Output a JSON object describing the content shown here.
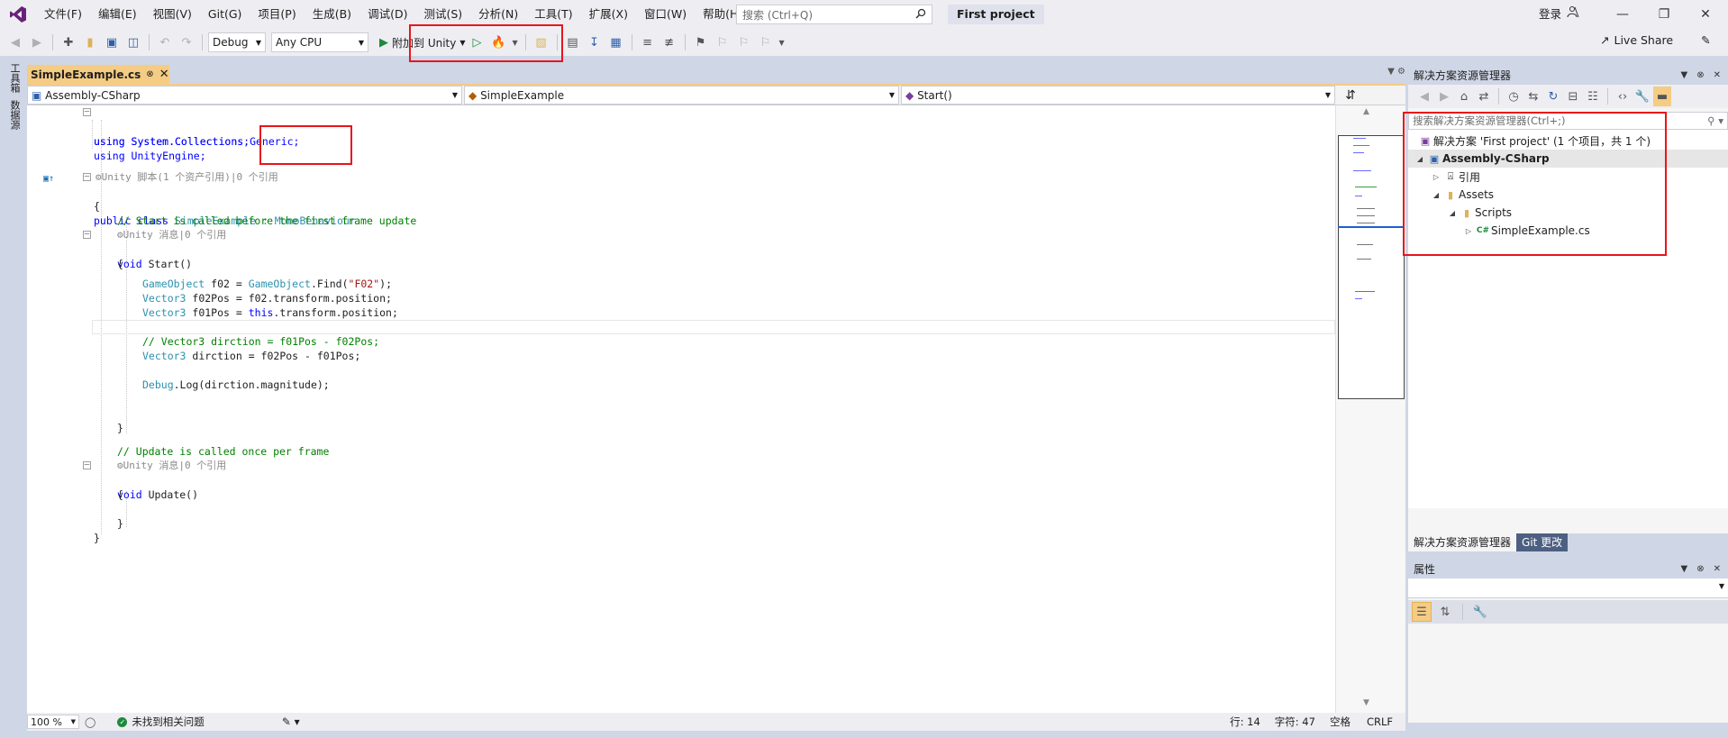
{
  "menubar": {
    "items": [
      "文件(F)",
      "编辑(E)",
      "视图(V)",
      "Git(G)",
      "项目(P)",
      "生成(B)",
      "调试(D)",
      "测试(S)",
      "分析(N)",
      "工具(T)",
      "扩展(X)",
      "窗口(W)",
      "帮助(H)"
    ],
    "search_placeholder": "搜索 (Ctrl+Q)",
    "project_name": "First project",
    "login": "登录"
  },
  "toolbar": {
    "configuration": "Debug",
    "platform": "Any CPU",
    "attach_label": "附加到 Unity",
    "live_share": "Live Share"
  },
  "left_strip": {
    "tabs": [
      "工具箱",
      "数据源"
    ]
  },
  "document": {
    "tab_title": "SimpleExample.cs"
  },
  "navbar": {
    "project": "Assembly-CSharp",
    "class": "SimpleExample",
    "member": "Start()"
  },
  "code": {
    "line_using1": "using System.Collections;",
    "line_using2": "using System.Collections.Generic;",
    "line_using3": "using UnityEngine;",
    "hint_class": "⚙Unity 脚本(1 个资产引用)|0 个引用",
    "class_decl_kw": "public class ",
    "class_name": "SimpleExample",
    "class_base": " : MonoBehaviour",
    "brace_open": "{",
    "brace_close": "}",
    "comment_start": "// Start is called before the first frame update",
    "hint_message1": "⚙Unity 消息|0 个引用",
    "start_decl_kw": "void ",
    "start_decl_name": "Start()",
    "line_f02_type": "GameObject",
    "line_f02_rest": " f02 = ",
    "line_f02_type2": "GameObject",
    "line_f02_call": ".Find(",
    "line_f02_str": "\"F02\"",
    "line_f02_end": ");",
    "line_f02pos_type": "Vector3",
    "line_f02pos_rest": " f02Pos = f02.transform.position;",
    "line_f01pos_type": "Vector3",
    "line_f01pos_mid": " f01Pos = ",
    "line_f01pos_this": "this",
    "line_f01pos_rest": ".transform.position;",
    "comment_dirction": "// Vector3 dirction = f01Pos - f02Pos;",
    "line_dir_type": "Vector3",
    "line_dir_rest": " dirction = f02Pos - f01Pos;",
    "line_debug_type": "Debug",
    "line_debug_rest": ".Log(dirction.magnitude);",
    "comment_update": "// Update is called once per frame",
    "hint_message2": "⚙Unity 消息|0 个引用",
    "update_decl_kw": "void ",
    "update_decl_name": "Update()"
  },
  "status": {
    "zoom": "100 %",
    "issues": "未找到相关问题",
    "line": "行: 14",
    "char": "字符: 47",
    "indent": "空格",
    "eol": "CRLF"
  },
  "solution_explorer": {
    "title": "解决方案资源管理器",
    "search_placeholder": "搜索解决方案资源管理器(Ctrl+;)",
    "tree": [
      {
        "label": "解决方案 'First project' (1 个项目，共 1 个)",
        "icon": "solution-icon"
      },
      {
        "label": "Assembly-CSharp",
        "icon": "csharp-project-icon"
      },
      {
        "label": "引用",
        "icon": "references-icon"
      },
      {
        "label": "Assets",
        "icon": "folder-icon"
      },
      {
        "label": "Scripts",
        "icon": "folder-icon"
      },
      {
        "label": "SimpleExample.cs",
        "icon": "csharp-file-icon"
      }
    ],
    "bottom_tabs": [
      "解决方案资源管理器",
      "Git 更改"
    ]
  },
  "properties": {
    "title": "属性"
  },
  "colors": {
    "accent_tab": "#f5cc84",
    "highlight_box": "#e8151b",
    "keyword": "#0000ff",
    "type": "#2b91af",
    "comment": "#008000",
    "string": "#a31515"
  }
}
